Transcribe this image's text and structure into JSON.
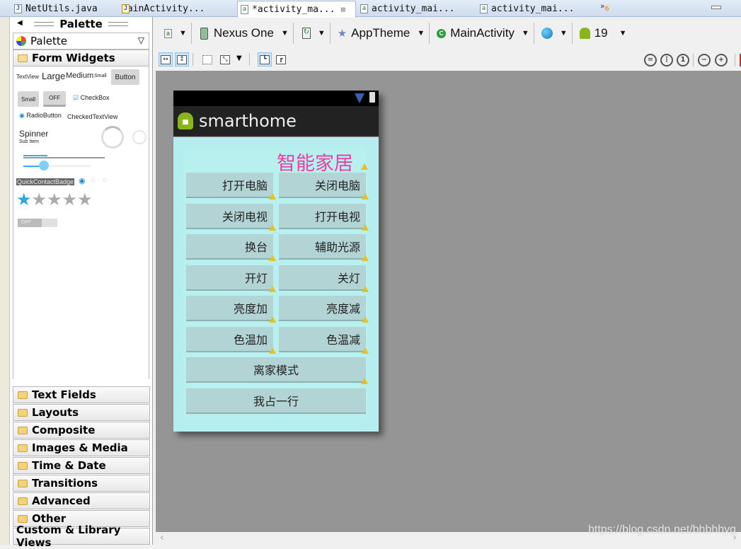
{
  "tabs": [
    {
      "label": "NetUtils.java",
      "icon": "java-file-icon",
      "active": false
    },
    {
      "label": "MainActivity...",
      "icon": "java-file-warning-icon",
      "active": false
    },
    {
      "label": "*activity_ma...",
      "icon": "xml-layout-file-icon",
      "active": true,
      "close": "⊠"
    },
    {
      "label": "activity_mai...",
      "icon": "xml-layout-file-icon",
      "active": false
    },
    {
      "label": "activity_mai...",
      "icon": "xml-layout-file-icon",
      "active": false
    }
  ],
  "tab_overflow": {
    "symbol": "»",
    "count": "6"
  },
  "palette": {
    "header": "Palette",
    "selector": "Palette",
    "open_category": "Form Widgets",
    "widgets": {
      "textview": "TextView",
      "large": "Large",
      "medium": "Medium",
      "small": "Small",
      "button": "Button",
      "small_button": "Small",
      "toggle_off": "OFF",
      "checkbox": "CheckBox",
      "radiobutton": "RadioButton",
      "checked_textview": "CheckedTextView",
      "spinner": "Spinner",
      "spinner_sub": "Sub Item",
      "quick_contact": "QuickContactBadge",
      "switch_off": "OFF",
      "rating_filled": 1,
      "rating_total": 5
    },
    "categories": [
      "Text Fields",
      "Layouts",
      "Composite",
      "Images & Media",
      "Time & Date",
      "Transitions",
      "Advanced",
      "Other"
    ],
    "custom": "Custom & Library Views"
  },
  "toolbar": {
    "device": "Nexus One",
    "theme": "AppTheme",
    "activity": "MainActivity",
    "api": "19"
  },
  "device": {
    "app_title": "smarthome",
    "heading": "智能家居",
    "buttons": [
      {
        "label": "打开电脑"
      },
      {
        "label": "关闭电脑"
      },
      {
        "label": "关闭电视"
      },
      {
        "label": "打开电视"
      },
      {
        "label": "换台"
      },
      {
        "label": "辅助光源"
      },
      {
        "label": "开灯"
      },
      {
        "label": "关灯"
      },
      {
        "label": "亮度加"
      },
      {
        "label": "亮度减"
      },
      {
        "label": "色温加"
      },
      {
        "label": "色温减"
      }
    ],
    "full_buttons": [
      {
        "label": "离家模式"
      },
      {
        "label": "我占一行"
      }
    ]
  },
  "watermark": "https://blog.csdn.net/bhbhhyg"
}
